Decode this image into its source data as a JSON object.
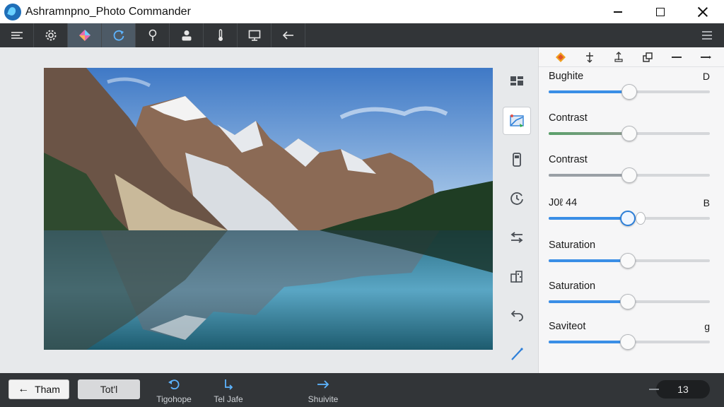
{
  "window": {
    "title": "Ashramnpno_Photo Commander"
  },
  "toolbar": {
    "items": [
      {
        "icon": "sliders-icon"
      },
      {
        "icon": "gear-icon"
      },
      {
        "icon": "color-diamond-icon",
        "active": true
      },
      {
        "icon": "rotate-icon",
        "active": true
      },
      {
        "icon": "pin-icon"
      },
      {
        "icon": "user-icon"
      },
      {
        "icon": "thermometer-icon"
      },
      {
        "icon": "monitor-icon"
      },
      {
        "icon": "back-arrow-icon"
      }
    ]
  },
  "side_tools": [
    {
      "icon": "grid-icon"
    },
    {
      "icon": "enhance-image-icon",
      "active": true
    },
    {
      "icon": "phone-icon"
    },
    {
      "icon": "clock-refresh-icon"
    },
    {
      "icon": "swap-icon"
    },
    {
      "icon": "buildings-icon"
    },
    {
      "icon": "undo-icon"
    },
    {
      "icon": "brush-icon"
    }
  ],
  "panel": {
    "tabs": [
      {
        "icon": "diamond-icon"
      },
      {
        "icon": "crop-icon"
      },
      {
        "icon": "transform-icon"
      },
      {
        "icon": "layers-icon"
      },
      {
        "icon": "minus-icon"
      },
      {
        "icon": "collapse-icon"
      }
    ],
    "adjustments": [
      {
        "label": "Bughite",
        "value": "D",
        "level": 0.5
      },
      {
        "label": "Contrast",
        "value": "",
        "level": 0.5
      },
      {
        "label": "Contrast",
        "value": "",
        "level": 0.5
      },
      {
        "label": "J0ℓ 44",
        "value": "B",
        "level": 0.49
      },
      {
        "label": "Saturation",
        "value": "",
        "level": 0.49
      },
      {
        "label": "Saturation",
        "value": "",
        "level": 0.49
      },
      {
        "label": "Savitеоt",
        "value": "g",
        "level": 0.49
      }
    ]
  },
  "bottom": {
    "back_label": "Tham",
    "tool_label": "Tot'l",
    "actions": [
      {
        "label": "Tigohope",
        "icon": "rotate-left-icon"
      },
      {
        "label": "Tel Jafe",
        "icon": "turn-down-icon"
      },
      {
        "label": "Shuivite",
        "icon": "arrow-right-icon"
      }
    ],
    "zoom_value": "13"
  },
  "colors": {
    "toolbar_bg": "#323538",
    "accent": "#3a8ee6",
    "panel_bg": "#f6f6f7"
  }
}
